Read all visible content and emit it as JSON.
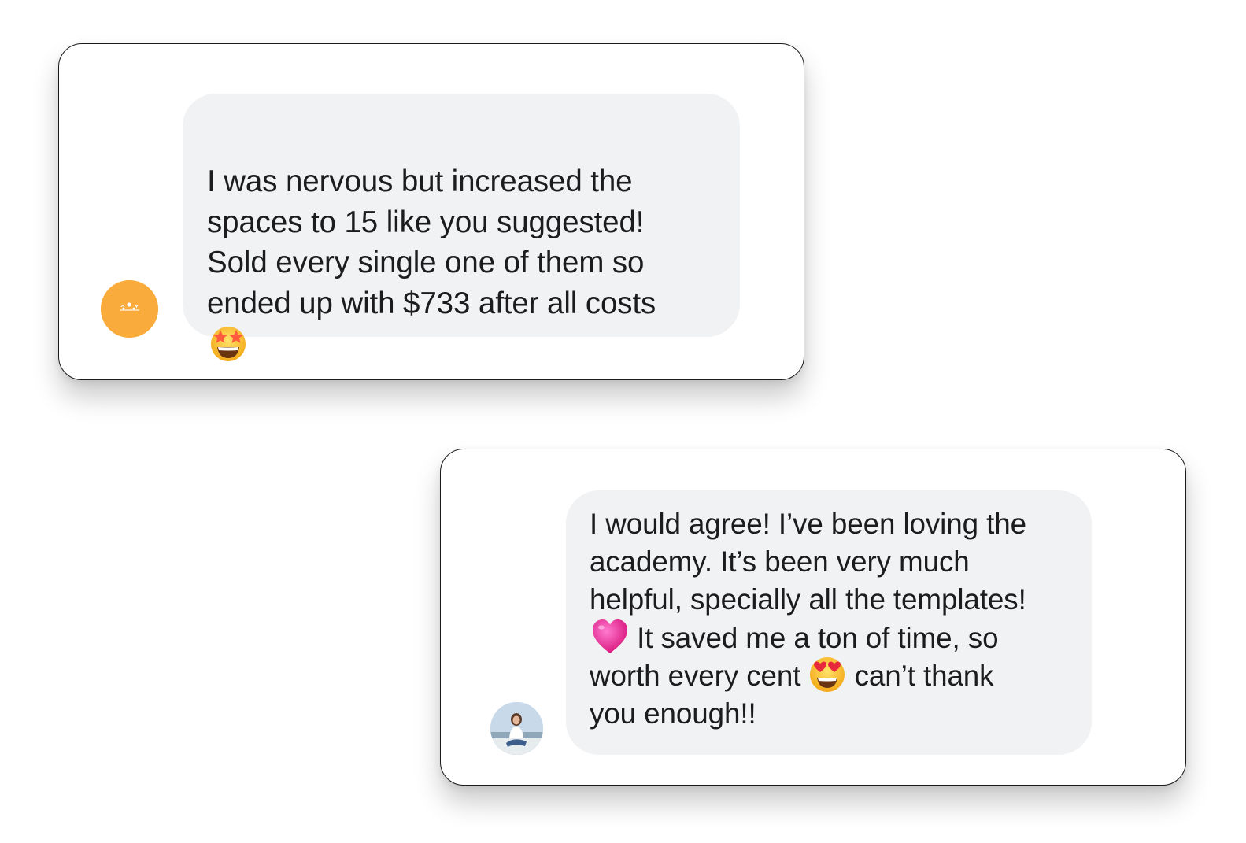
{
  "messages": [
    {
      "lines": [
        "I was nervous but increased the",
        "spaces to 15 like you suggested!",
        "Sold every single one of them so",
        "ended up with $733 after all costs"
      ],
      "emoji_icon": "star-struck-emoji",
      "avatar_icon": "orange-logo-avatar",
      "avatar_color": "#f9ab3c"
    },
    {
      "line1": "I would agree! I’ve been loving the",
      "line2": "academy. It’s been very much",
      "line3": "helpful, specially all the templates!",
      "line4_text": " It saved me a ton of time, so",
      "line5_text": "worth every cent ",
      "line5_after": " can’t thank",
      "line6": "you enough!!",
      "heart_icon": "pink-heart-emoji",
      "heart_eyes_icon": "heart-eyes-emoji",
      "avatar_icon": "woman-photo-avatar"
    }
  ],
  "colors": {
    "bubble": "#f1f2f4",
    "text": "#1c1c1e",
    "heart": "#ec2e9a",
    "emoji_face": "#fbc02d"
  }
}
